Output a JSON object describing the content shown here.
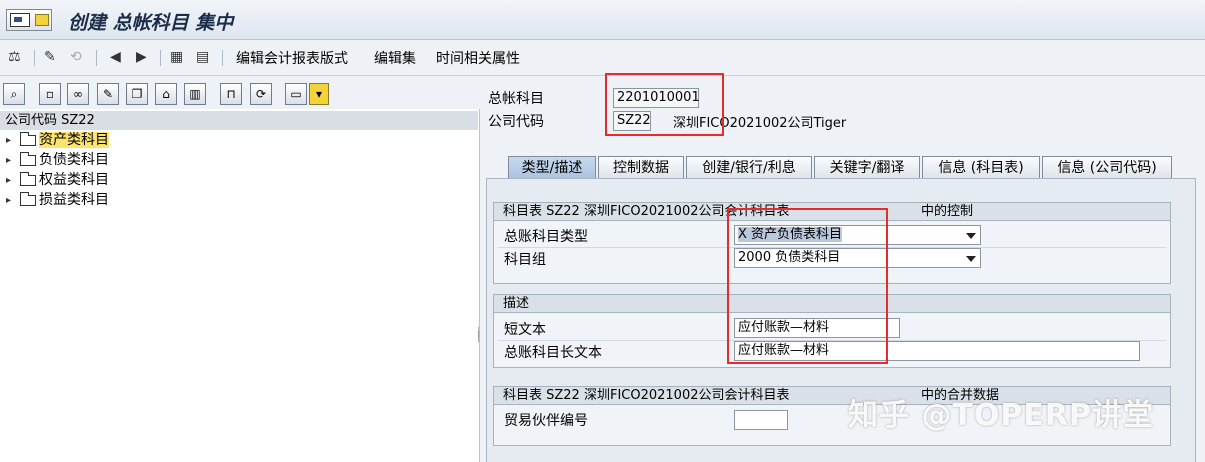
{
  "window": {
    "title": "创建 总帐科目 集中"
  },
  "toolbar": {
    "items": [
      "编辑会计报表版式",
      "编辑集",
      "时间相关属性"
    ]
  },
  "left": {
    "header": "公司代码 SZ22",
    "tree": [
      "资产类科目",
      "负债类科目",
      "权益类科目",
      "损益类科目"
    ]
  },
  "header": {
    "gl_account_label": "总帐科目",
    "gl_account_value": "2201010001",
    "company_code_label": "公司代码",
    "company_code_value": "SZ22",
    "company_name": "深圳FICO2021002公司Tiger"
  },
  "tabs": [
    "类型/描述",
    "控制数据",
    "创建/银行/利息",
    "关键字/翻译",
    "信息 (科目表)",
    "信息 (公司代码)"
  ],
  "group_control": {
    "title": "科目表 SZ22 深圳FICO2021002公司会计科目表",
    "title_right": "中的控制",
    "account_type_label": "总账科目类型",
    "account_type_value": "X 资产负债表科目",
    "account_group_label": "科目组",
    "account_group_value": "2000 负债类科目"
  },
  "group_desc": {
    "title": "描述",
    "short_text_label": "短文本",
    "short_text_value": "应付账款—材料",
    "long_text_label": "总账科目长文本",
    "long_text_value": "应付账款—材料"
  },
  "group_consol": {
    "title": "科目表 SZ22 深圳FICO2021002公司会计科目表",
    "title_right": "中的合并数据",
    "partner_label": "贸易伙伴编号",
    "partner_value": ""
  },
  "watermark": "知乎 @TOPERP讲堂"
}
